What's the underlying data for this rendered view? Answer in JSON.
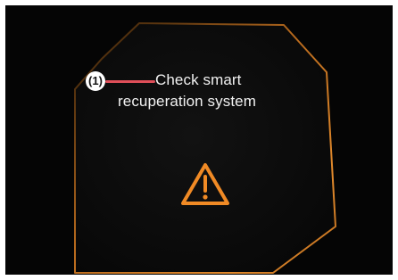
{
  "callout": {
    "label": "(1)"
  },
  "message": {
    "line1": "Check smart",
    "line2": "recuperation system"
  },
  "icons": {
    "warning": "warning-triangle-icon"
  },
  "colors": {
    "background": "#050505",
    "panel_border": "#b86a1d",
    "warning": "#f08a25",
    "callout_line": "#e04f59",
    "text": "#f2f2f2"
  }
}
